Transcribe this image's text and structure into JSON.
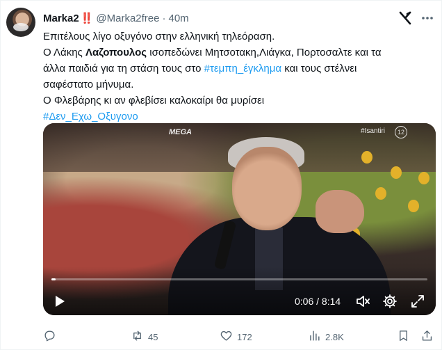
{
  "tweet": {
    "author_name": "Marka2",
    "author_badge": "‼️",
    "handle": "@Marka2free",
    "separator": "·",
    "time": "40m",
    "text_line1": "Επιτέλους λίγο οξυγόνο στην ελληνική τηλεόραση.",
    "text_line2_prefix": "Ο Λάκης ",
    "text_line2_bold": "Λαζοπουλος",
    "text_line2_suffix": " ισοπεδώνει  Μητσοτακη,Λιάγκα, Πορτοσαλτε και τα",
    "text_line3_prefix": "άλλα παιδιά για τη στάση τους στο ",
    "text_line3_hashtag": "#τεμπη_έγκλημα",
    "text_line3_suffix": " και τους στέλνει",
    "text_line4": "σαφέστατο μήνυμα.",
    "text_line5": "Ο Φλεβάρης κι αν φλεβίσει καλοκαίρι θα μυρίσει",
    "hashtag2": "#Δεν_Εχω_Οξυγονο"
  },
  "video": {
    "channel_logo": "MEGA",
    "on_screen_hashtag": "#Isantiri",
    "rating_badge": "12",
    "current_time": "0:06",
    "time_separator": " / ",
    "duration": "8:14",
    "progress_fraction": 0.012,
    "icons": [
      "play-icon",
      "volume-muted-icon",
      "settings-icon",
      "fullscreen-icon"
    ]
  },
  "actions": {
    "reply_count": "",
    "retweet_count": "45",
    "like_count": "172",
    "views_count": "2.8K",
    "icons": [
      "reply-icon",
      "retweet-icon",
      "like-icon",
      "views-icon",
      "bookmark-icon",
      "share-icon"
    ]
  },
  "colors": {
    "link": "#1d9bf0",
    "secondary_text": "#536471",
    "primary_text": "#0f1419"
  }
}
